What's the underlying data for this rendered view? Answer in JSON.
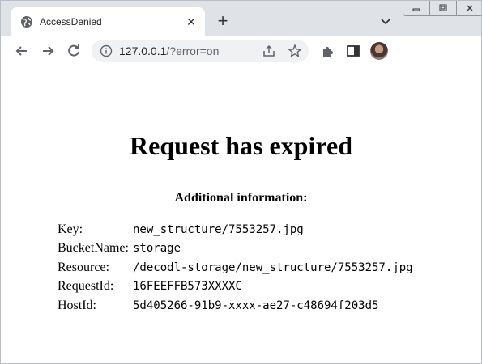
{
  "browser": {
    "tab_title": "AccessDenied",
    "url_host": "127.0.0.1",
    "url_path": "/?error=on"
  },
  "page": {
    "heading": "Request has expired",
    "subheading": "Additional information:",
    "info": [
      {
        "key": "Key:",
        "value": "new_structure/7553257.jpg"
      },
      {
        "key": "BucketName:",
        "value": "storage"
      },
      {
        "key": "Resource:",
        "value": "/decodl-storage/new_structure/7553257.jpg"
      },
      {
        "key": "RequestId:",
        "value": "16FEEFFB573XXXXC"
      },
      {
        "key": "HostId:",
        "value": "5d405266-91b9-xxxx-ae27-c48694f203d5"
      }
    ]
  }
}
